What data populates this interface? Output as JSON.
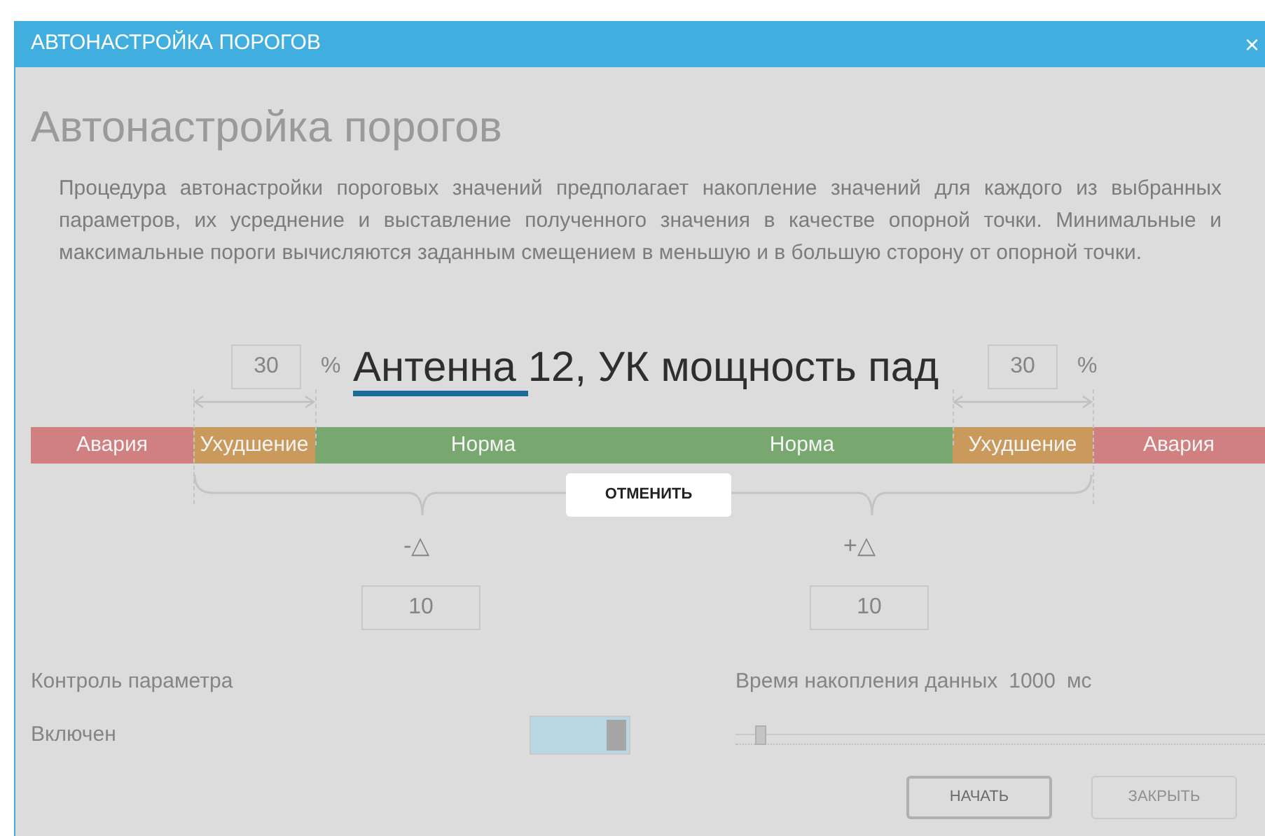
{
  "window": {
    "title": "АВТОНАСТРОЙКА ПОРОГОВ",
    "close": "×"
  },
  "heading": "Автонастройка порогов",
  "description": "Процедура автонастройки пороговых значений предполагает накопление значений для каждого из выбранных параметров, их усреднение и выставление полученного значения в качестве опорной точки. Минимальные и максимальные пороги вычисляются заданным смещением в меньшую и в большую сторону от опорной точки.",
  "thresholds": {
    "lower_percent": {
      "value": "30",
      "unit": "%"
    },
    "upper_percent": {
      "value": "30",
      "unit": "%"
    },
    "zones": [
      {
        "label": "Авария",
        "kind": "alarm"
      },
      {
        "label": "Ухудшение",
        "kind": "warning"
      },
      {
        "label": "Норма",
        "kind": "normal"
      },
      {
        "label": "Норма",
        "kind": "normal"
      },
      {
        "label": "Ухудшение",
        "kind": "warning"
      },
      {
        "label": "Авария",
        "kind": "alarm"
      }
    ],
    "minus_delta": {
      "label": "-△",
      "value": "10"
    },
    "plus_delta": {
      "label": "+△",
      "value": "10"
    }
  },
  "control": {
    "label": "Контроль параметра",
    "state_label": "Включен",
    "on": true
  },
  "accumulation": {
    "label": "Время накопления данных",
    "value": "1000",
    "unit": "мс",
    "level": 0.02
  },
  "buttons": [
    {
      "label": "НАЧАТЬ",
      "disabled": false
    },
    {
      "label": "ЗАКРЫТЬ",
      "disabled": true
    }
  ],
  "progress_overlay": {
    "text": "Антенна 12, УК мощность пад",
    "level": 0.3,
    "cancel": "ОТМЕНИТЬ"
  }
}
